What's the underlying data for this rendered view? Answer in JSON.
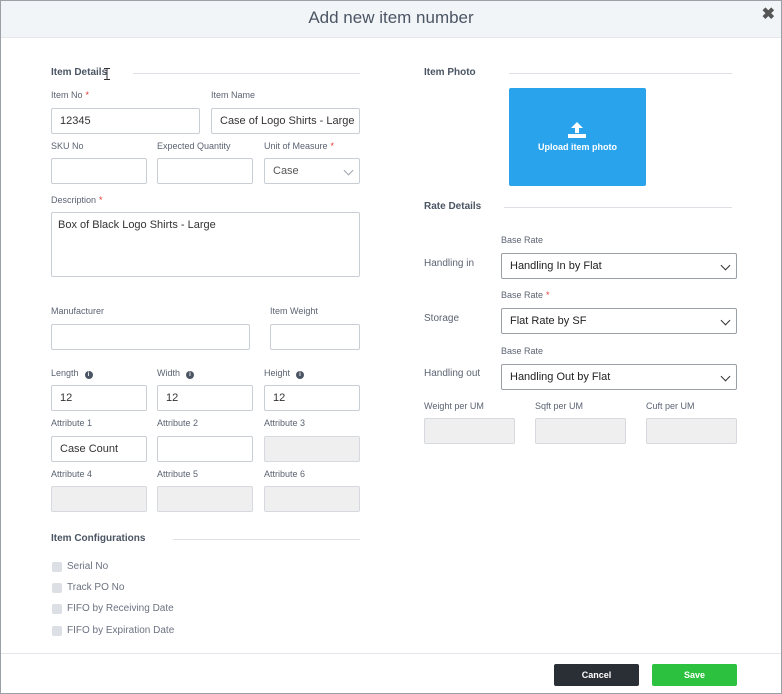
{
  "dialog": {
    "title": "Add new item number",
    "close_glyph": "✖"
  },
  "item_details": {
    "heading": "Item Details",
    "item_no": {
      "label": "Item No",
      "value": "12345"
    },
    "item_name": {
      "label": "Item Name",
      "value": "Case of Logo Shirts - Large"
    },
    "sku_no": {
      "label": "SKU No",
      "value": ""
    },
    "expected_quantity": {
      "label": "Expected Quantity",
      "value": ""
    },
    "unit_of_measure": {
      "label": "Unit of Measure",
      "value": "Case"
    },
    "description": {
      "label": "Description",
      "value": "Box of Black Logo Shirts - Large"
    },
    "manufacturer": {
      "label": "Manufacturer",
      "value": ""
    },
    "item_weight": {
      "label": "Item Weight",
      "value": ""
    },
    "length": {
      "label": "Length",
      "value": "12"
    },
    "width": {
      "label": "Width",
      "value": "12"
    },
    "height": {
      "label": "Height",
      "value": "12"
    },
    "attribute_1": {
      "label": "Attribute 1",
      "value": "Case Count"
    },
    "attribute_2": {
      "label": "Attribute 2",
      "value": ""
    },
    "attribute_3": {
      "label": "Attribute 3",
      "value": ""
    },
    "attribute_4": {
      "label": "Attribute 4",
      "value": ""
    },
    "attribute_5": {
      "label": "Attribute 5",
      "value": ""
    },
    "attribute_6": {
      "label": "Attribute 6",
      "value": ""
    },
    "required_marker": "*",
    "info_glyph": "i"
  },
  "item_configurations": {
    "heading": "Item Configurations",
    "options": [
      "Serial No",
      "Track PO No",
      "FIFO by Receiving Date",
      "FIFO by Expiration Date"
    ]
  },
  "item_photo": {
    "heading": "Item Photo",
    "upload_label": "Upload item photo",
    "upload_icon": "upload-icon"
  },
  "rate_details": {
    "heading": "Rate Details",
    "base_rate_label": "Base Rate",
    "handling_in": {
      "label": "Handling in",
      "value": "Handling In by Flat"
    },
    "storage": {
      "label": "Storage",
      "value": "Flat Rate by SF"
    },
    "handling_out": {
      "label": "Handling out",
      "value": "Handling Out by Flat"
    },
    "weight_per_um": {
      "label": "Weight per UM",
      "value": ""
    },
    "sqft_per_um": {
      "label": "Sqft per UM",
      "value": ""
    },
    "cuft_per_um": {
      "label": "Cuft per UM",
      "value": ""
    }
  },
  "footer": {
    "cancel_label": "Cancel",
    "save_label": "Save"
  },
  "colors": {
    "accent_blue": "#29a3ec",
    "save_green": "#2cc13f",
    "cancel_dark": "#2a2f36",
    "required_red": "#e53935"
  }
}
